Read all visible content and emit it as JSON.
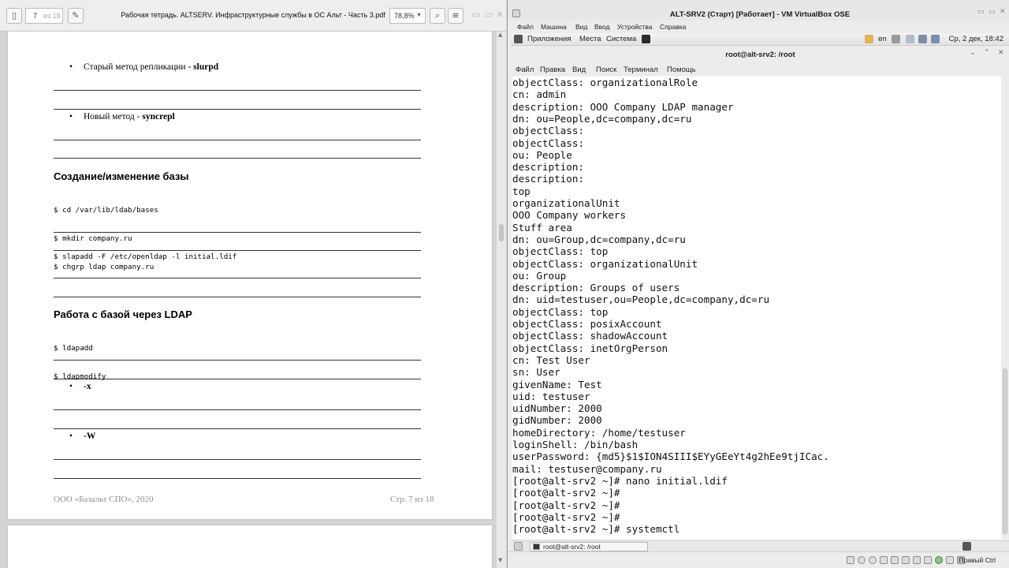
{
  "pdf": {
    "page_current": "7",
    "page_of": "из 18",
    "title": "Рабочая тетрадь. ALTSERV. Инфраструктурные службы в ОС Альт - Часть 3.pdf",
    "zoom": "78,8%",
    "content": {
      "bullet1_prefix": "Старый метод репликации - ",
      "bullet1_bold": "slurpd",
      "bullet2_prefix": "Новый метод - ",
      "bullet2_bold": "syncrepl",
      "heading1": "Создание/изменение базы",
      "code1": [
        "$ cd /var/lib/ldab/bases",
        "$ mkdir company.ru",
        "$ chgrp ldap company.ru"
      ],
      "code2": "$ slapadd -F /etc/openldap -l initial.ldif",
      "heading2": "Работа с базой через LDAP",
      "code3": [
        "$ ldapadd",
        "$ ldapmodify"
      ],
      "bullet3": "-x",
      "bullet4": "-W",
      "footer_left": "ООО «Базальт СПО», 2020",
      "footer_right": "Стр. 7   из 18"
    }
  },
  "vbox": {
    "title": "ALT-SRV2 (Старт) [Работает] - VM VirtualBox OSE",
    "menu": [
      "Файл",
      "Машина",
      "Вид",
      "Ввод",
      "Устройства",
      "Справка"
    ],
    "host_key": "Правый Ctrl"
  },
  "guest_panel": {
    "menu": [
      "Приложения",
      "Места",
      "Система"
    ],
    "lang": "en",
    "clock": "Ср,  2 дек, 18:42"
  },
  "terminal": {
    "title": "root@alt-srv2: /root",
    "menu": [
      "Файл",
      "Правка",
      "Вид",
      "Поиск",
      "Терминал",
      "Помощь"
    ],
    "lines": [
      "objectClass: organizationalRole",
      "cn: admin",
      "description: OOO Company LDAP manager",
      "dn: ou=People,dc=company,dc=ru",
      "objectClass:",
      "objectClass:",
      "ou: People",
      "description:",
      "description:",
      "top",
      "organizationalUnit",
      "OOO Company workers",
      "Stuff area",
      "dn: ou=Group,dc=company,dc=ru",
      "objectClass: top",
      "objectClass: organizationalUnit",
      "ou: Group",
      "description: Groups of users",
      "dn: uid=testuser,ou=People,dc=company,dc=ru",
      "objectClass: top",
      "objectClass: posixAccount",
      "objectClass: shadowAccount",
      "objectClass: inetOrgPerson",
      "cn: Test User",
      "sn: User",
      "givenName: Test",
      "uid: testuser",
      "uidNumber: 2000",
      "gidNumber: 2000",
      "homeDirectory: /home/testuser",
      "loginShell: /bin/bash",
      "userPassword: {md5}$1$ION4SIII$EYyGEeYt4g2hEe9tjICac.",
      "mail: testuser@company.ru",
      "[root@alt-srv2 ~]# nano initial.ldif",
      "[root@alt-srv2 ~]#",
      "[root@alt-srv2 ~]#",
      "[root@alt-srv2 ~]#",
      "[root@alt-srv2 ~]# systemctl"
    ]
  },
  "taskbar": {
    "item": "root@alt-srv2: /root"
  }
}
